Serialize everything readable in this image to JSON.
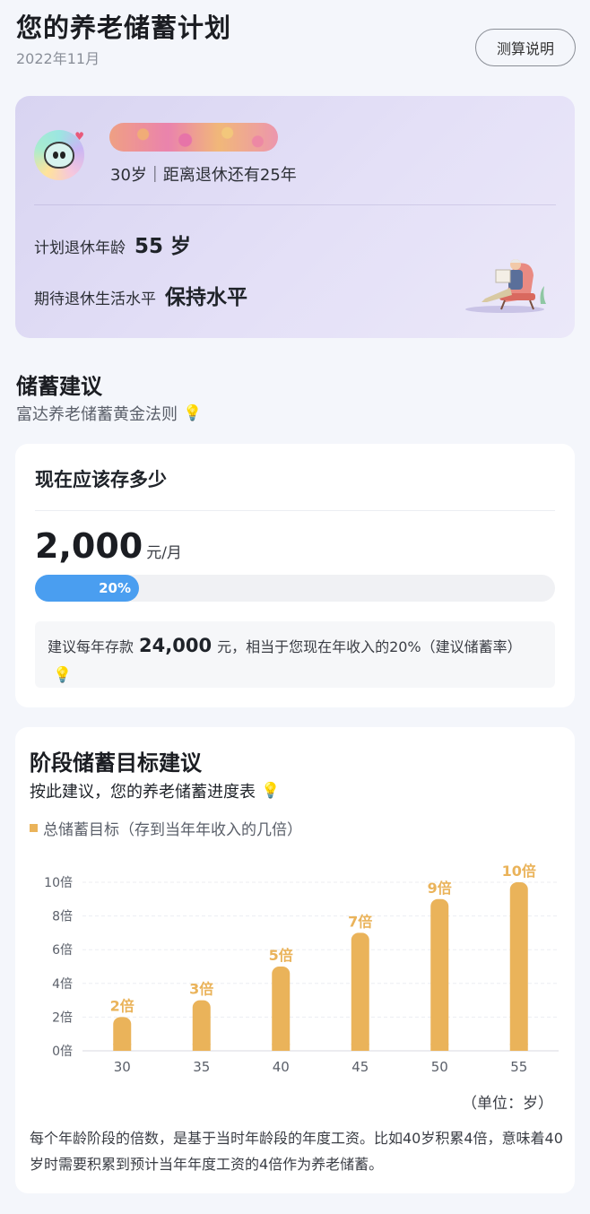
{
  "header": {
    "title": "您的养老储蓄计划",
    "date": "2022年11月",
    "explain_button": "测算说明"
  },
  "profile": {
    "age_text": "30岁｜距离退休还有25年",
    "retire_age_label": "计划退休年龄",
    "retire_age_value": "55 岁",
    "life_level_label": "期待退休生活水平",
    "life_level_value": "保持水平"
  },
  "savings_section": {
    "title": "储蓄建议",
    "subtitle": "富达养老储蓄黄金法则"
  },
  "save_card": {
    "title": "现在应该存多少",
    "amount": "2,000",
    "amount_unit": "元/月",
    "progress_percent": 20,
    "progress_label": "20%",
    "advice_prefix": "建议每年存款",
    "advice_amount": "24,000",
    "advice_suffix": "元，相当于您现在年收入的20%（建议储蓄率）"
  },
  "stage_card": {
    "title": "阶段储蓄目标建议",
    "subtitle": "按此建议，您的养老储蓄进度表",
    "legend": "总储蓄目标（存到当年年收入的几倍）",
    "unit_note": "（单位：岁）",
    "footnote": "每个年龄阶段的倍数，是基于当时年龄段的年度工资。比如40岁积累4倍，意味着40岁时需要积累到预计当年年度工资的4倍作为养老储蓄。"
  },
  "chart_data": {
    "type": "bar",
    "categories": [
      "30",
      "35",
      "40",
      "45",
      "50",
      "55"
    ],
    "values": [
      2,
      3,
      5,
      7,
      9,
      10
    ],
    "value_labels": [
      "2倍",
      "3倍",
      "5倍",
      "7倍",
      "9倍",
      "10倍"
    ],
    "y_ticks": [
      "0倍",
      "2倍",
      "4倍",
      "6倍",
      "8倍",
      "10倍"
    ],
    "ylim": [
      0,
      10
    ],
    "series_name": "总储蓄目标（存到当年年收入的几倍）",
    "bar_color": "#eab35a",
    "grid": true,
    "xlabel": "（单位：岁）"
  },
  "colors": {
    "accent_blue": "#4a9ef0",
    "bar_orange": "#eab35a"
  }
}
